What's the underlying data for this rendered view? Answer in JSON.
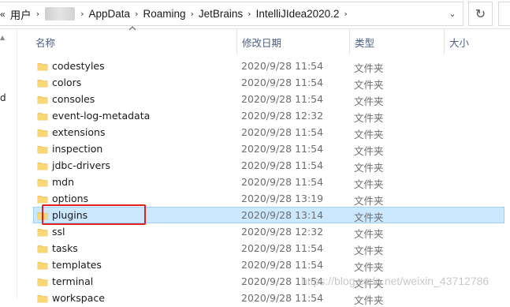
{
  "address_bar": {
    "overflow_chevron": "«",
    "breadcrumbs": [
      "用户",
      "AppData",
      "Roaming",
      "JetBrains",
      "IntelliJIdea2020.2"
    ],
    "separator": "›",
    "dropdown_glyph": "⌄",
    "refresh_glyph": "↻"
  },
  "nav_pane": {
    "clipped_text": "d"
  },
  "columns": {
    "name": "名称",
    "modified": "修改日期",
    "type": "类型",
    "size": "大小"
  },
  "rows": [
    {
      "name": "codestyles",
      "modified": "2020/9/28 11:54",
      "type": "文件夹"
    },
    {
      "name": "colors",
      "modified": "2020/9/28 11:54",
      "type": "文件夹"
    },
    {
      "name": "consoles",
      "modified": "2020/9/28 11:54",
      "type": "文件夹"
    },
    {
      "name": "event-log-metadata",
      "modified": "2020/9/28 12:32",
      "type": "文件夹"
    },
    {
      "name": "extensions",
      "modified": "2020/9/28 11:54",
      "type": "文件夹"
    },
    {
      "name": "inspection",
      "modified": "2020/9/28 11:54",
      "type": "文件夹"
    },
    {
      "name": "jdbc-drivers",
      "modified": "2020/9/28 11:54",
      "type": "文件夹"
    },
    {
      "name": "mdn",
      "modified": "2020/9/28 11:54",
      "type": "文件夹"
    },
    {
      "name": "options",
      "modified": "2020/9/28 13:19",
      "type": "文件夹"
    },
    {
      "name": "plugins",
      "modified": "2020/9/28 13:14",
      "type": "文件夹",
      "selected": true
    },
    {
      "name": "ssl",
      "modified": "2020/9/28 12:32",
      "type": "文件夹"
    },
    {
      "name": "tasks",
      "modified": "2020/9/28 11:54",
      "type": "文件夹"
    },
    {
      "name": "templates",
      "modified": "2020/9/28 11:54",
      "type": "文件夹"
    },
    {
      "name": "terminal",
      "modified": "2020/9/28 11:54",
      "type": "文件夹"
    },
    {
      "name": "workspace",
      "modified": "2020/9/28 11:54",
      "type": "文件夹"
    }
  ],
  "watermark": "https://blog.csdn.net/weixin_43712786",
  "colors": {
    "selection_bg": "#cce8ff",
    "selection_border": "#99d1ff",
    "highlight_box": "#e02020",
    "header_text": "#4d6082",
    "folder_fill": "#f8d775",
    "folder_tab": "#e9b84a"
  }
}
